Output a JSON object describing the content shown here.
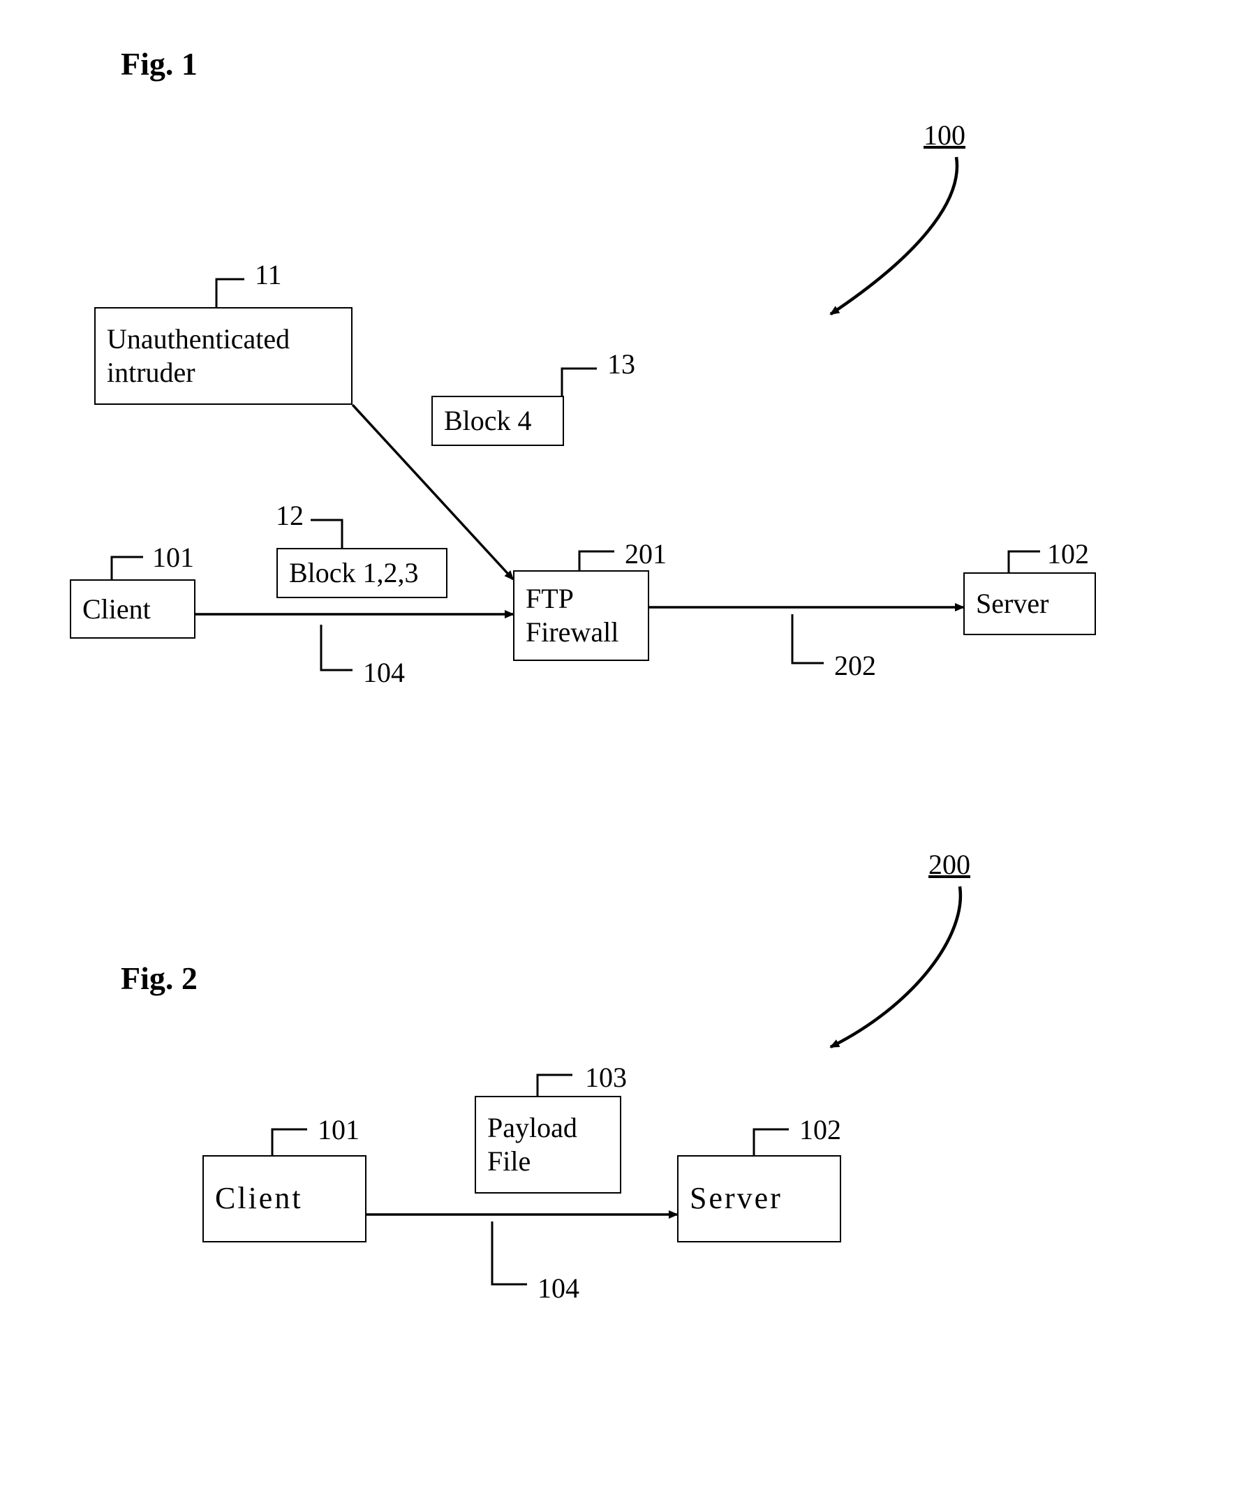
{
  "fig1": {
    "title": "Fig. 1",
    "ref": "100",
    "boxes": {
      "intruder": {
        "label": "Unauthenticated\nintruder",
        "ref": "11"
      },
      "block4": {
        "label": "Block 4",
        "ref": "13"
      },
      "block123": {
        "label": "Block 1,2,3",
        "ref": "12"
      },
      "client": {
        "label": "Client",
        "ref": "101"
      },
      "firewall": {
        "label": "FTP\nFirewall",
        "ref": "201"
      },
      "server": {
        "label": "Server",
        "ref": "102"
      }
    },
    "arrows": {
      "client_to_fw": "104",
      "fw_to_server": "202"
    }
  },
  "fig2": {
    "title": "Fig. 2",
    "ref": "200",
    "boxes": {
      "client": {
        "label": "Client",
        "ref": "101"
      },
      "payload": {
        "label": "Payload\nFile",
        "ref": "103"
      },
      "server": {
        "label": "Server",
        "ref": "102"
      }
    },
    "arrows": {
      "client_to_server": "104"
    }
  }
}
